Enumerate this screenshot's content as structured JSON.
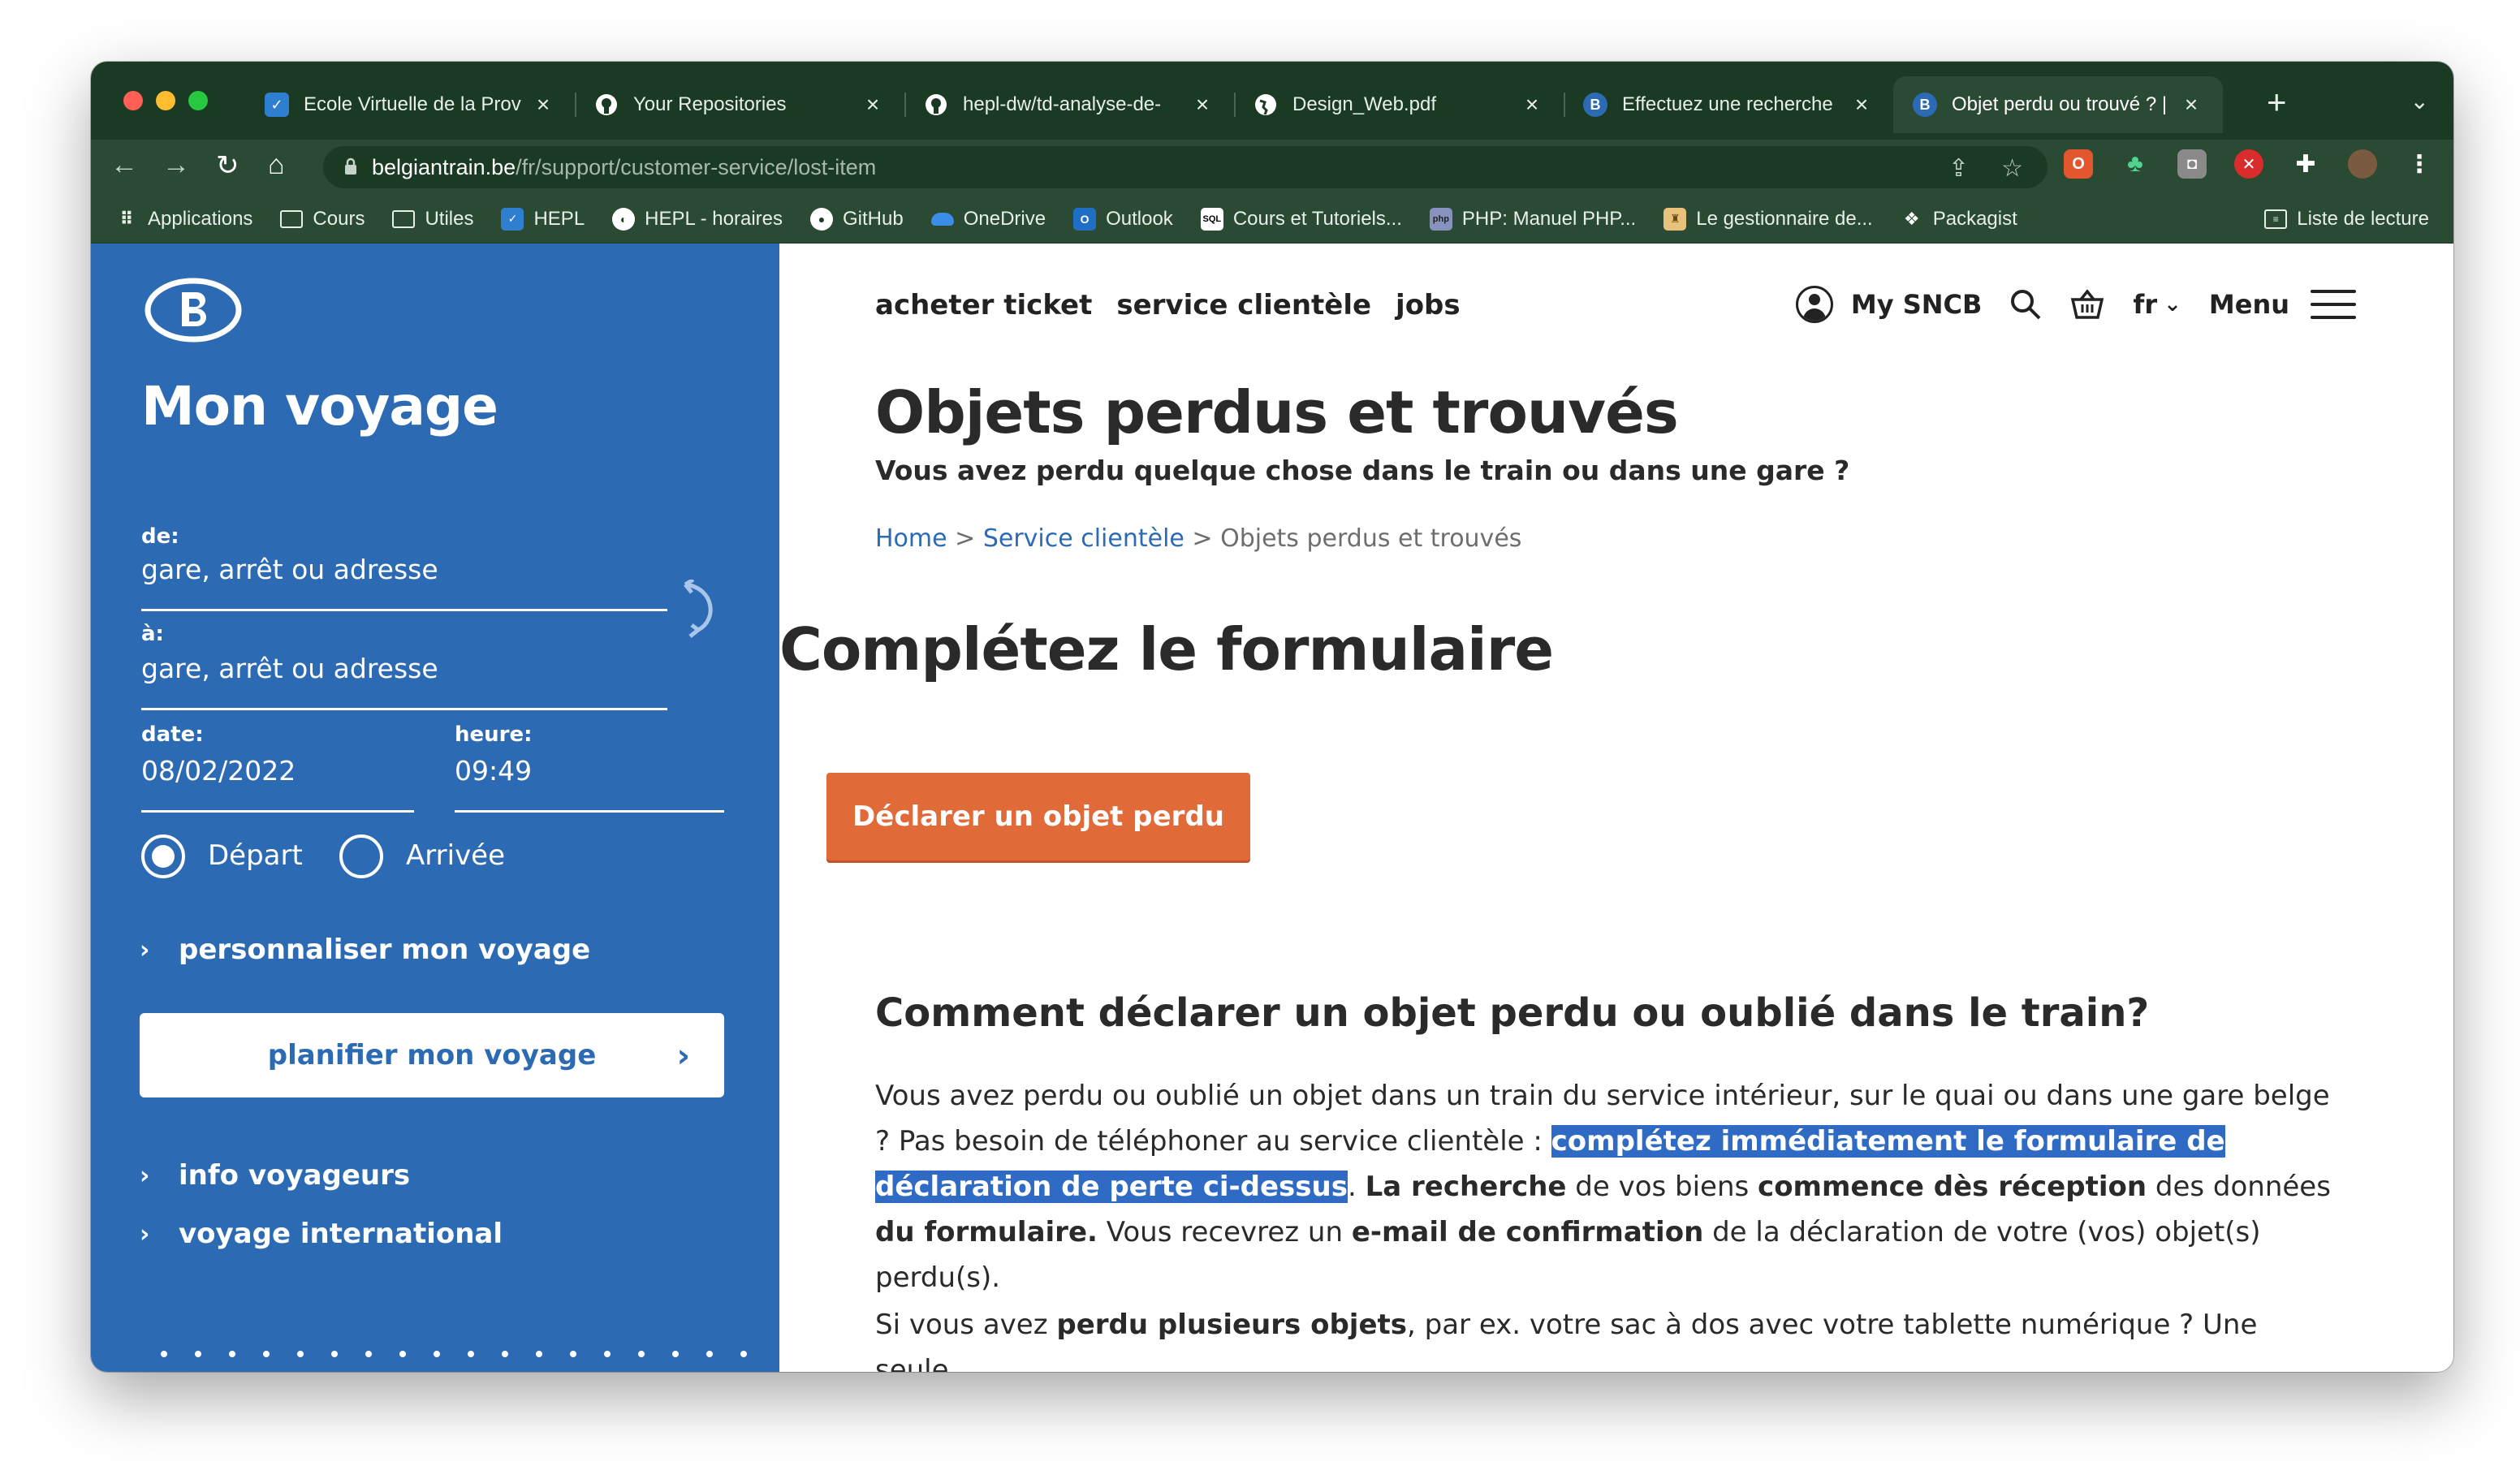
{
  "browser": {
    "tabs": [
      {
        "title": "Ecole Virtuelle de la Prov",
        "icon": "ecole-virtuelle-icon",
        "active": false
      },
      {
        "title": "Your Repositories",
        "icon": "github-icon",
        "active": false
      },
      {
        "title": "hepl-dw/td-analyse-de-",
        "icon": "github-icon",
        "active": false
      },
      {
        "title": "Design_Web.pdf",
        "icon": "globe-icon",
        "active": false
      },
      {
        "title": "Effectuez une recherche",
        "icon": "sncb-icon",
        "active": false
      },
      {
        "title": "Objet perdu ou trouvé ? |",
        "icon": "sncb-icon",
        "active": true
      }
    ],
    "new_tab": "+",
    "url_host": "belgiantrain.be",
    "url_path": "/fr/support/customer-service/lost-item",
    "bookmarks": [
      {
        "label": "Applications",
        "icon": "apps-grid-icon"
      },
      {
        "label": "Cours",
        "icon": "folder-icon"
      },
      {
        "label": "Utiles",
        "icon": "folder-icon"
      },
      {
        "label": "HEPL",
        "icon": "ecole-virtuelle-icon"
      },
      {
        "label": "HEPL - horaires",
        "icon": "globe-icon"
      },
      {
        "label": "GitHub",
        "icon": "github-icon"
      },
      {
        "label": "OneDrive",
        "icon": "onedrive-icon"
      },
      {
        "label": "Outlook",
        "icon": "outlook-icon"
      },
      {
        "label": "Cours et Tutoriels...",
        "icon": "sql-icon"
      },
      {
        "label": "PHP: Manuel PHP...",
        "icon": "php-icon"
      },
      {
        "label": "Le gestionnaire de...",
        "icon": "composer-icon"
      },
      {
        "label": "Packagist",
        "icon": "packagist-icon"
      }
    ],
    "reading_list": "Liste de lecture"
  },
  "sidebar": {
    "title": "Mon voyage",
    "from_label": "de:",
    "from_placeholder": "gare, arrêt ou adresse",
    "to_label": "à:",
    "to_placeholder": "gare, arrêt ou adresse",
    "date_label": "date:",
    "date_value": "08/02/2022",
    "time_label": "heure:",
    "time_value": "09:49",
    "departure_label": "Départ",
    "arrival_label": "Arrivée",
    "customize_label": "personnaliser mon voyage",
    "plan_button": "planifier mon voyage",
    "info_link": "info voyageurs",
    "international_link": "voyage international"
  },
  "header": {
    "nav": [
      "acheter ticket",
      "service clientèle",
      "jobs"
    ],
    "my_sncb": "My SNCB",
    "language": "fr",
    "menu": "Menu"
  },
  "content": {
    "title": "Objets perdus et trouvés",
    "subtitle": "Vous avez perdu quelque chose dans le train ou dans une gare ?",
    "breadcrumb": {
      "home": "Home",
      "sep1": " > ",
      "service": "Service clientèle",
      "sep2": " > ",
      "current": "Objets perdus et trouvés"
    },
    "form_heading": "Complétez le formulaire",
    "declare_button": "Déclarer un objet perdu",
    "how_heading": "Comment déclarer un objet perdu ou oublié dans le train?",
    "para1": {
      "t1": "Vous avez perdu ou oublié un objet dans un train du service intérieur, sur le quai ou dans une gare belge ? Pas besoin de téléphoner au service clientèle : ",
      "highlight": "complétez immédiatement le formulaire de déclaration de perte ci-dessus",
      "t2": ". ",
      "b1": "La recherche",
      "t3": " de vos biens ",
      "b2": "commence dès réception",
      "t4": " des données ",
      "b3": "du formulaire.",
      "t5": " Vous recevrez un ",
      "b4": "e-mail de confirmation",
      "t6": " de la déclaration de votre (vos) objet(s) perdu(s)."
    },
    "para2": {
      "t1": "Si vous avez ",
      "b1": "perdu plusieurs objets",
      "t2": ", par ex. votre sac à dos avec votre tablette numérique ? Une seule"
    }
  },
  "colors": {
    "sidebar_bg": "#2c6ab4",
    "accent_orange": "#e06a38",
    "browser_frame": "#1b3a24",
    "selection": "#2f6bc4"
  }
}
